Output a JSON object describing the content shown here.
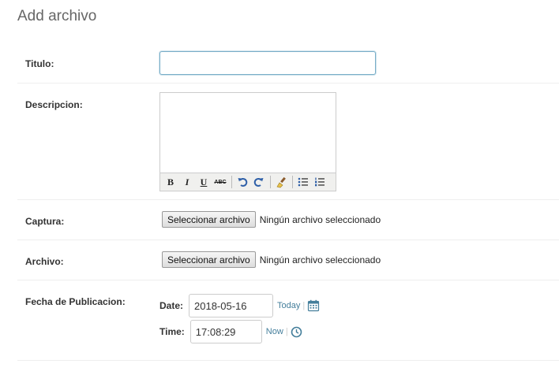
{
  "page": {
    "title": "Add archivo"
  },
  "fields": {
    "titulo": {
      "label": "Titulo:",
      "value": "",
      "placeholder": ""
    },
    "descripcion": {
      "label": "Descripcion:",
      "toolbar": {
        "bold": "B",
        "italic": "I",
        "underline": "U",
        "strikethrough": "ABC",
        "icons": [
          "undo-icon",
          "redo-icon",
          "cleanup-brush-icon",
          "bullet-list-icon",
          "numbered-list-icon"
        ]
      }
    },
    "captura": {
      "label": "Captura:",
      "button_label": "Seleccionar archivo",
      "status": "Ningún archivo seleccionado"
    },
    "archivo": {
      "label": "Archivo:",
      "button_label": "Seleccionar archivo",
      "status": "Ningún archivo seleccionado"
    },
    "fecha": {
      "label": "Fecha de Publicacion:",
      "date_label": "Date:",
      "date_value": "2018-05-16",
      "today_link": "Today",
      "time_label": "Time:",
      "time_value": "17:08:29",
      "now_link": "Now",
      "separator": "|",
      "icons": [
        "calendar-icon",
        "clock-icon"
      ]
    }
  },
  "colors": {
    "link": "#447e9b",
    "focus_border": "#79aec8",
    "row_border": "#eeeeee"
  }
}
